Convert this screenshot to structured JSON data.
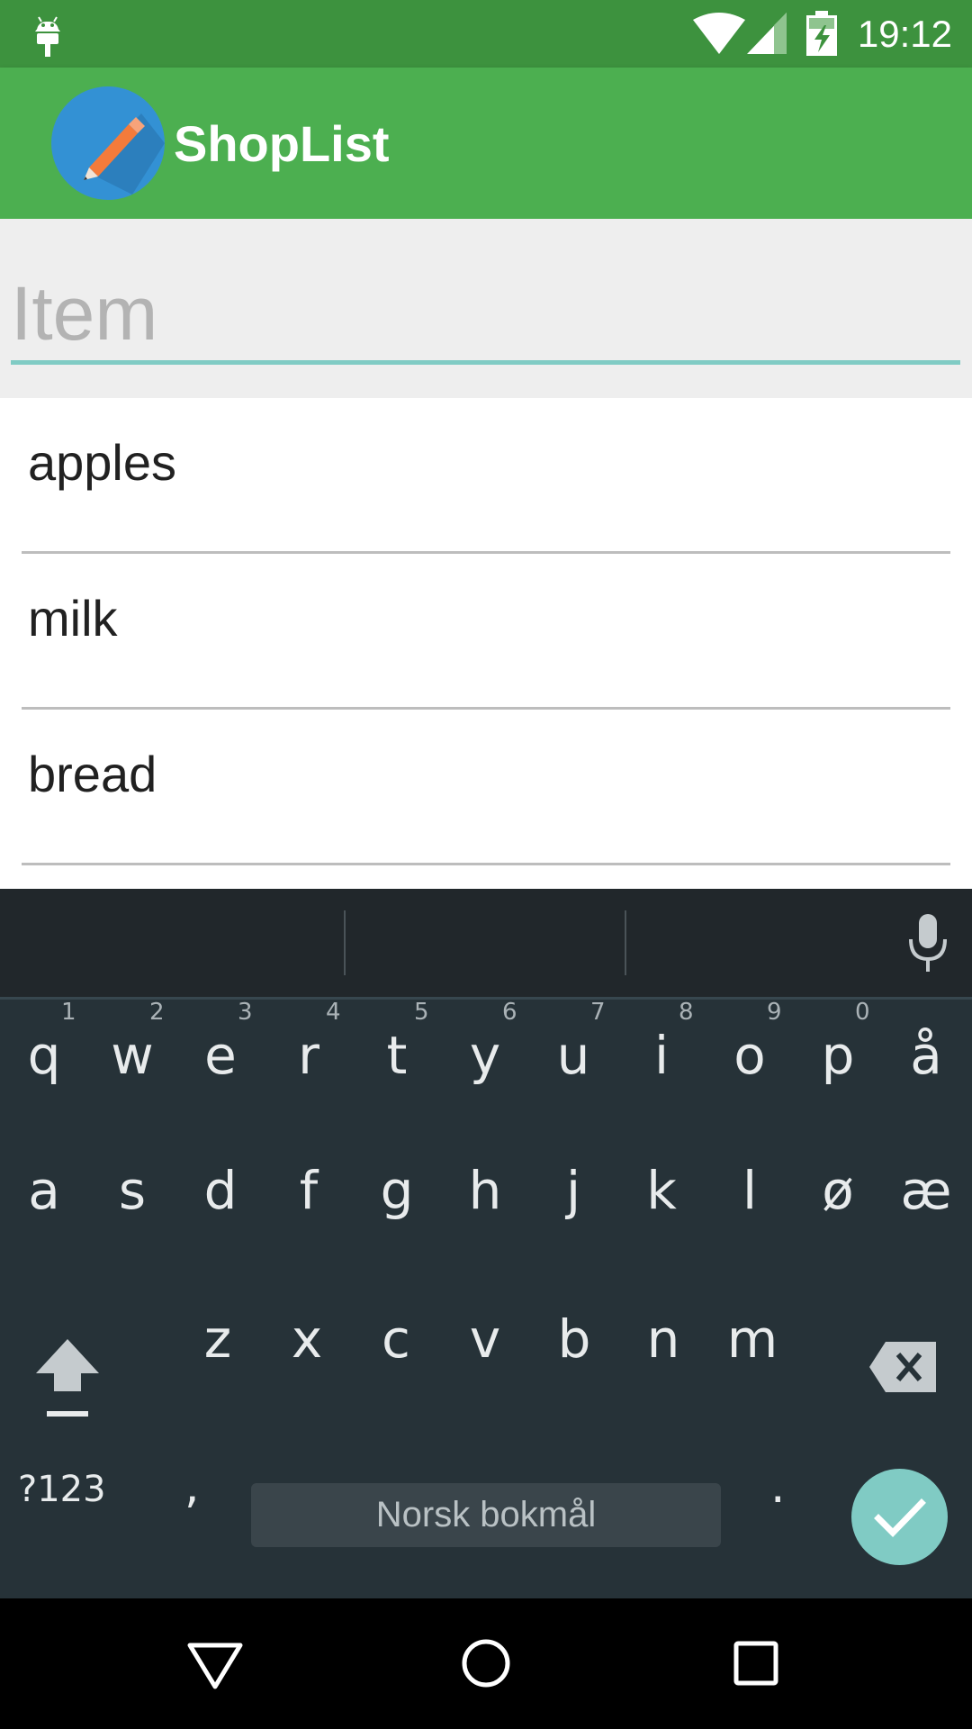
{
  "status_bar": {
    "time": "19:12"
  },
  "app_bar": {
    "title": "ShopList"
  },
  "item_input": {
    "placeholder": "Item",
    "value": ""
  },
  "list_items": [
    "apples",
    "milk",
    "bread"
  ],
  "keyboard": {
    "row1": [
      {
        "key": "q",
        "hint": "1"
      },
      {
        "key": "w",
        "hint": "2"
      },
      {
        "key": "e",
        "hint": "3"
      },
      {
        "key": "r",
        "hint": "4"
      },
      {
        "key": "t",
        "hint": "5"
      },
      {
        "key": "y",
        "hint": "6"
      },
      {
        "key": "u",
        "hint": "7"
      },
      {
        "key": "i",
        "hint": "8"
      },
      {
        "key": "o",
        "hint": "9"
      },
      {
        "key": "p",
        "hint": "0"
      },
      {
        "key": "å",
        "hint": ""
      }
    ],
    "row2": [
      "a",
      "s",
      "d",
      "f",
      "g",
      "h",
      "j",
      "k",
      "l",
      "ø",
      "æ"
    ],
    "row3": [
      "z",
      "x",
      "c",
      "v",
      "b",
      "n",
      "m"
    ],
    "symbols_label": "?123",
    "comma": ",",
    "space_label": "Norsk bokmål",
    "period": "."
  },
  "colors": {
    "status_bar": "#3d923e",
    "app_bar": "#4caf50",
    "accent": "#80cbc4",
    "keyboard_bg": "#263238"
  }
}
